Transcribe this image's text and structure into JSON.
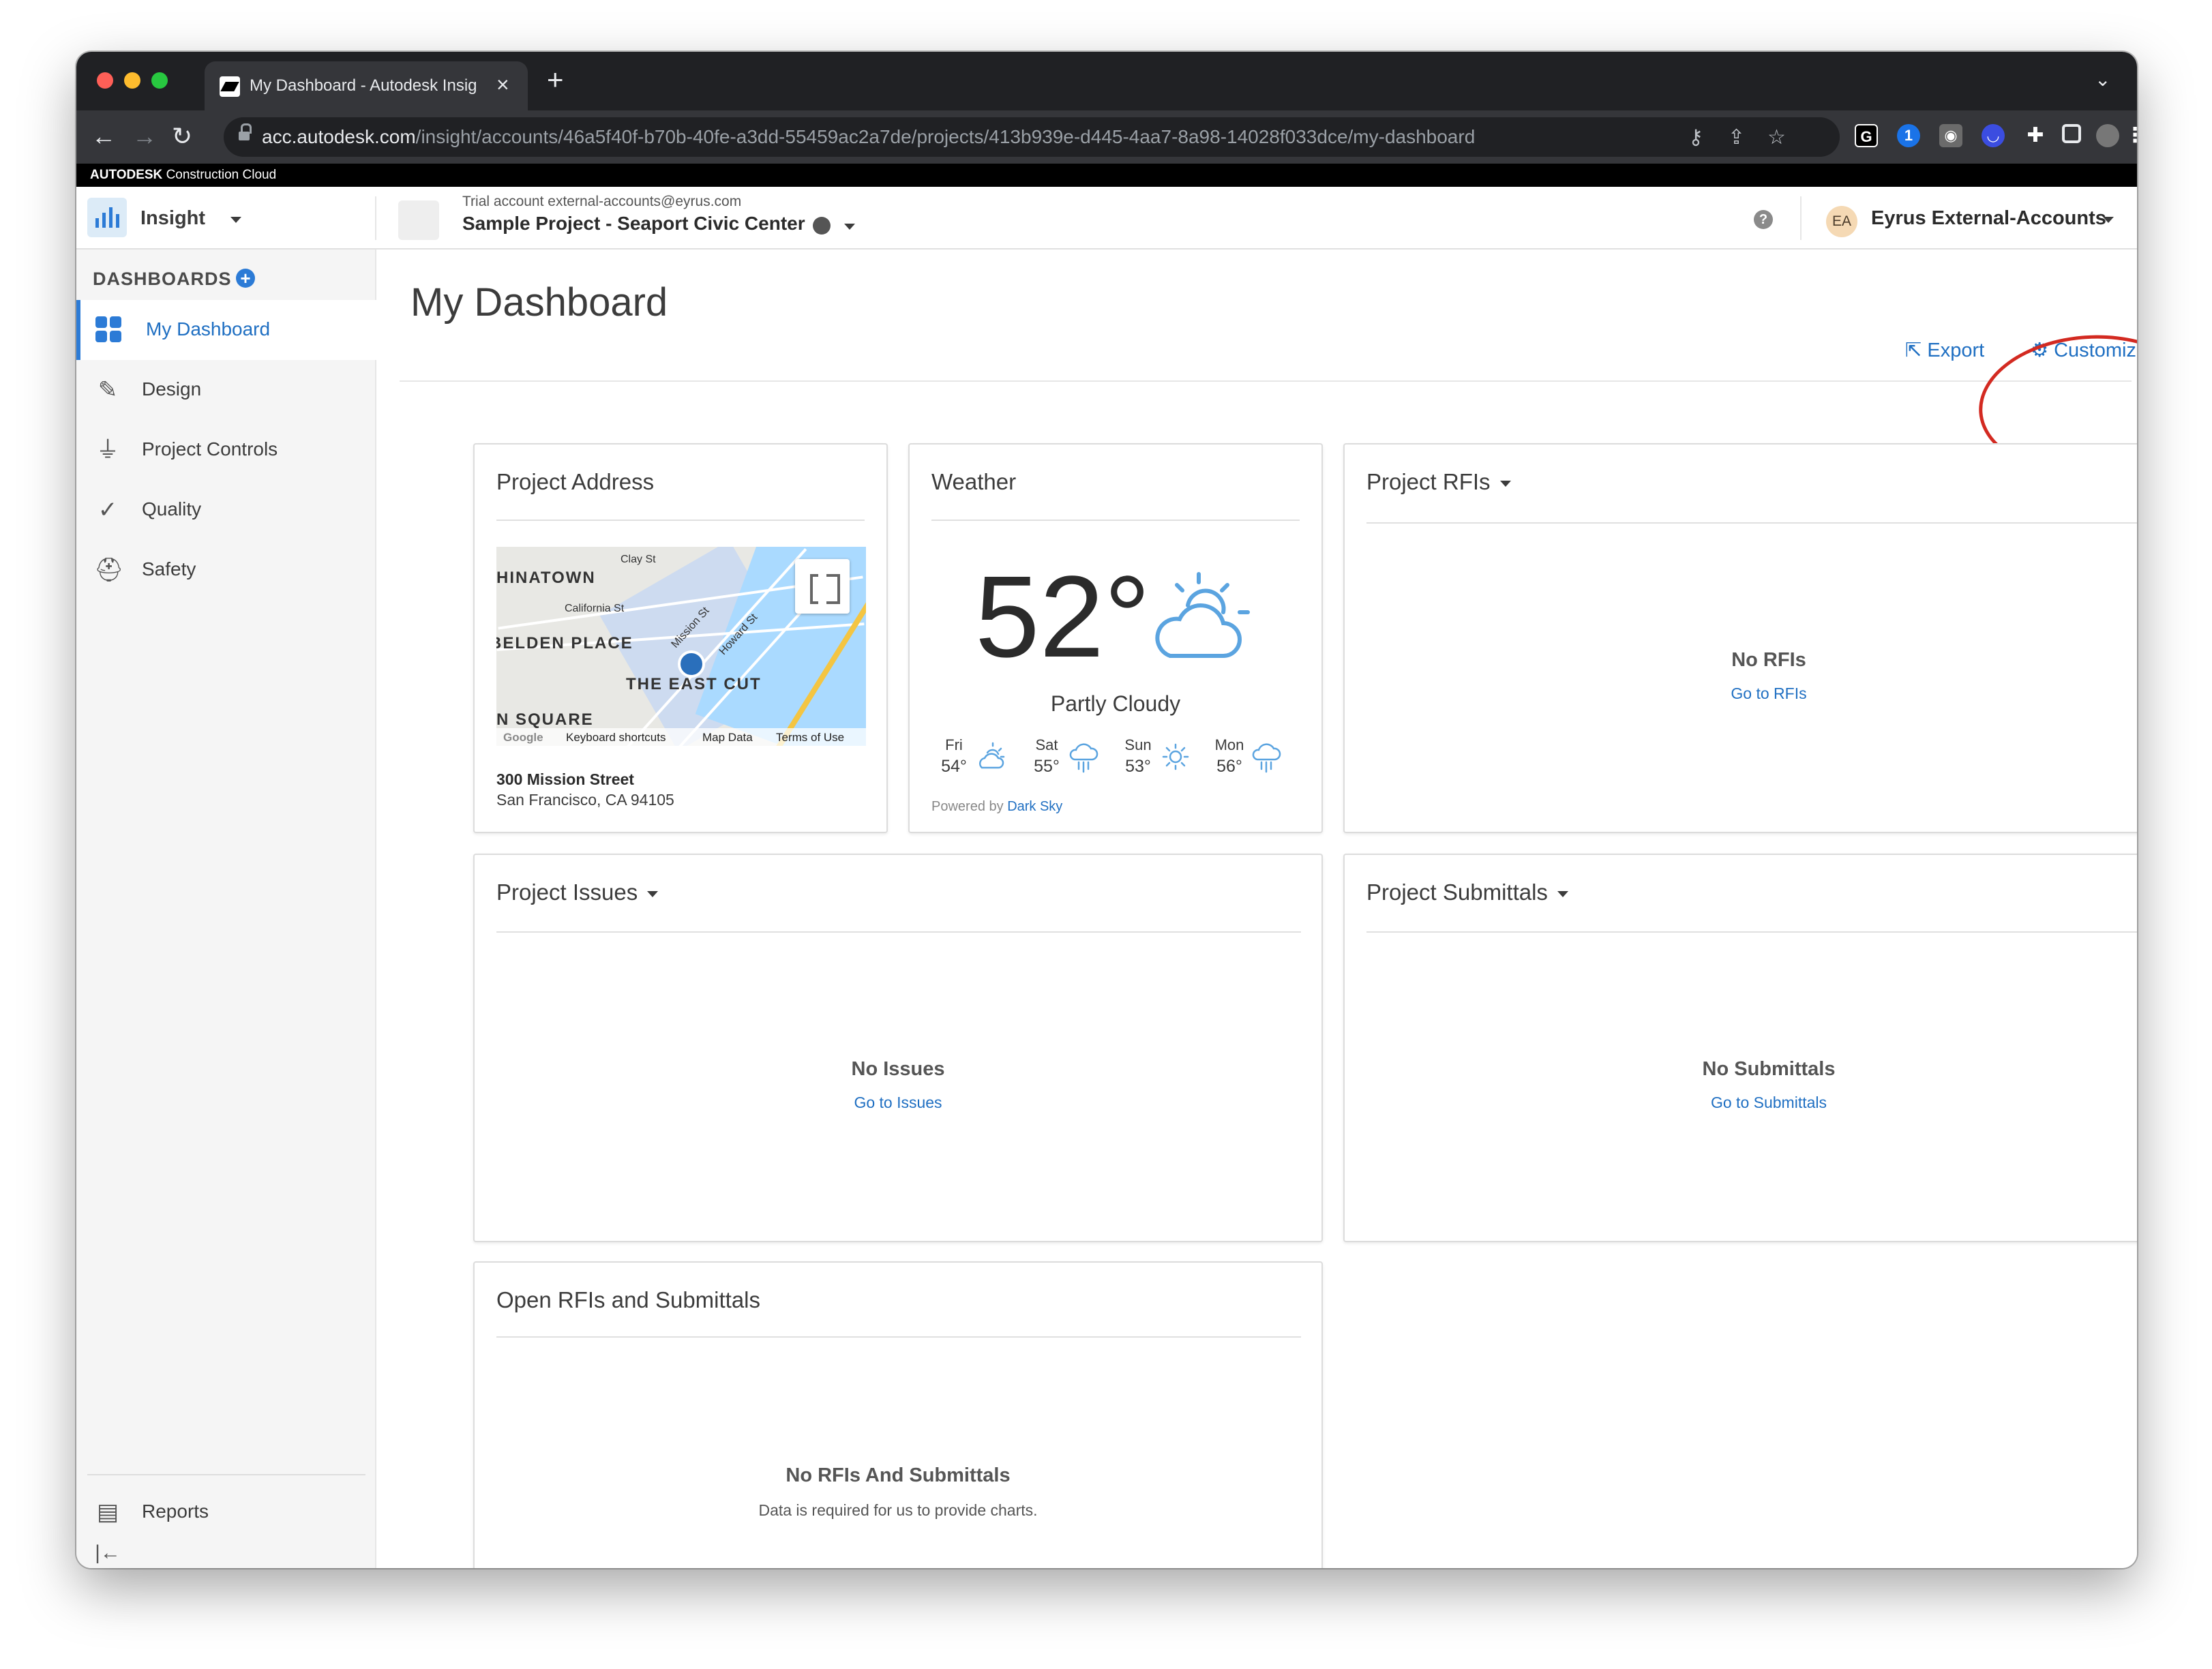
{
  "browser": {
    "tab_title": "My Dashboard - Autodesk Insig",
    "url_host": "acc.autodesk.com",
    "url_path": "/insight/accounts/46a5f40f-b70b-40fe-a3dd-55459ac2a7de/projects/413b939e-d445-4aa7-8a98-14028f033dce/my-dashboard",
    "traffic_light_colors": [
      "#ff5f57",
      "#febc2e",
      "#28c840"
    ]
  },
  "banner": {
    "brand": "AUTODESK",
    "product": "Construction Cloud"
  },
  "header": {
    "module": "Insight",
    "trial_text": "Trial account external-accounts@eyrus.com",
    "project_name": "Sample Project - Seaport Civic Center",
    "help_icon": "?",
    "user_initials": "EA",
    "user_name": "Eyrus External-Accounts"
  },
  "sidebar": {
    "heading": "DASHBOARDS",
    "add_icon": "+",
    "items": [
      {
        "label": "My Dashboard",
        "icon": "grid-icon",
        "active": true
      },
      {
        "label": "Design",
        "icon": "edit-icon"
      },
      {
        "label": "Project Controls",
        "icon": "hierarchy-icon"
      },
      {
        "label": "Quality",
        "icon": "check-icon"
      },
      {
        "label": "Safety",
        "icon": "hardhat-icon"
      }
    ],
    "bottom_items": [
      {
        "label": "Reports",
        "icon": "report-icon"
      }
    ],
    "collapse_icon": "|←"
  },
  "main": {
    "title": "My Dashboard",
    "export_label": "Export",
    "customize_label": "Customize",
    "accent_color": "#1f6fc2",
    "annotation_color": "#d32a21"
  },
  "cards": {
    "address": {
      "title": "Project Address",
      "street": "300 Mission Street",
      "city": "San Francisco, CA 94105",
      "map": {
        "labels": [
          "HINATOWN",
          "Clay St",
          "California St",
          "BELDEN PLACE",
          "Mission St",
          "Howard St",
          "THE EAST CUT",
          "N SQUARE"
        ],
        "footer": [
          "Keyboard shortcuts",
          "Map Data",
          "Terms of Use"
        ],
        "google_mark": "Google"
      }
    },
    "weather": {
      "title": "Weather",
      "temperature": "52°",
      "condition": "Partly Cloudy",
      "forecast": [
        {
          "day": "Fri",
          "temp": "54°",
          "icon": "partly-cloudy-icon"
        },
        {
          "day": "Sat",
          "temp": "55°",
          "icon": "rain-icon"
        },
        {
          "day": "Sun",
          "temp": "53°",
          "icon": "sun-icon"
        },
        {
          "day": "Mon",
          "temp": "56°",
          "icon": "rain-icon"
        }
      ],
      "powered_prefix": "Powered by",
      "powered_link": "Dark Sky"
    },
    "rfis": {
      "title": "Project RFIs",
      "empty_title": "No RFIs",
      "link": "Go to RFIs"
    },
    "issues": {
      "title": "Project Issues",
      "empty_title": "No Issues",
      "link": "Go to Issues"
    },
    "submittals": {
      "title": "Project Submittals",
      "empty_title": "No Submittals",
      "link": "Go to Submittals"
    },
    "open": {
      "title": "Open RFIs and Submittals",
      "empty_title": "No RFIs And Submittals",
      "note": "Data is required for us to provide charts."
    }
  }
}
